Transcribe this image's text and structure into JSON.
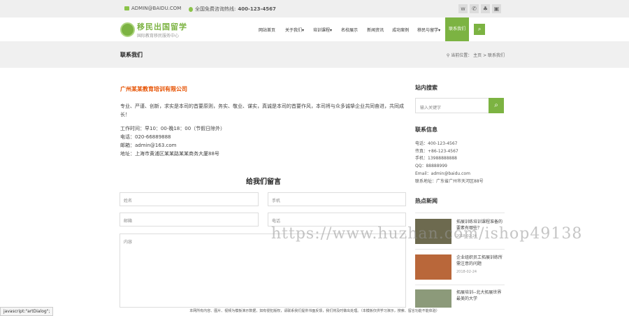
{
  "topbar": {
    "email": "ADMIN@BAIDU.COM",
    "hotline_label": "全国免费咨询热线:",
    "hotline": "400-123-4567"
  },
  "brand": {
    "name": "移民出国留学",
    "tagline": "国际教育移民服务中心"
  },
  "nav": {
    "items": [
      "网站首页",
      "关于我们▾",
      "培训课程▾",
      "名校展示",
      "新闻资讯",
      "成功案例",
      "移民与留学▾",
      "联系我们"
    ],
    "active_index": 7
  },
  "page": {
    "title": "联系我们",
    "breadcrumb_prefix": "当前位置：",
    "breadcrumb": "主页 > 联系我们"
  },
  "company": {
    "name": "广州某某教育培训有限公司",
    "intro": "专业、严谨、创新，求实是本司的首要原则，务实、敬业、谋实，真诚是本司的首要作风，本司将与众多诚挚企业共同奋进，共同成长！",
    "info": [
      "工作时间：早10：00-晚18：00（节假日除外）",
      "电话：020-66889888",
      "邮箱：admin@163.com",
      "地址：上海市黄浦区某某路某某商务大厦88号"
    ]
  },
  "form": {
    "title": "给我们留言",
    "name_ph": "姓名",
    "phone_ph": "手机",
    "email_ph": "邮箱",
    "tel_ph": "电话",
    "content_ph": "内容"
  },
  "sidebar": {
    "search_title": "站内搜索",
    "search_ph": "输入关键字",
    "contact_title": "联系信息",
    "contact": [
      "电话：400-123-4567",
      "传真：+86-123-4567",
      "手机：13988888888",
      "QQ：88888999",
      "Email：admin@baidu.com",
      "联系地址：广东省广州市天河区88号"
    ],
    "news_title": "热点新闻",
    "news": [
      {
        "title": "拓展训练培训课程准备的要素有哪些？",
        "date": "2018-02-24"
      },
      {
        "title": "企业组织员工拓展训练所需注意的问题",
        "date": "2018-02-24"
      },
      {
        "title": "拓展培训--北大拓展世界最美的大学",
        "date": ""
      }
    ]
  },
  "footer": {
    "text": "本网所有内容、图片、视频为模板演示数据，如有侵犯版权，请联系我们提供书面反馈，我们将及时做出处理。（本模板仅供学习演示，搜索、留言功能不能体验）"
  },
  "statusbar": "javascript:\"artDialog\";",
  "watermark": "https://www.huzhan.com/ishop49138",
  "colors": {
    "accent": "#7cb342",
    "company": "#e65100"
  }
}
